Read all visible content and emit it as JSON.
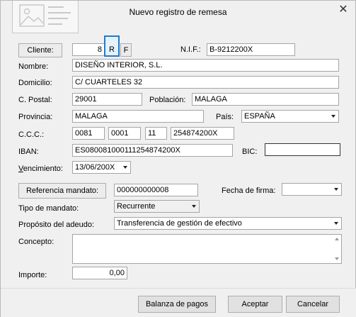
{
  "window": {
    "title": "Nuevo registro de remesa",
    "close_glyph": "✕"
  },
  "cliente": {
    "button_label": "Cliente:",
    "code": "8",
    "btn_r": "R",
    "btn_f": "F"
  },
  "nif": {
    "label": "N.I.F.:",
    "value": "B-9212200X"
  },
  "nombre": {
    "label": "Nombre:",
    "value": "DISEÑO INTERIOR, S.L."
  },
  "domicilio": {
    "label": "Domicilio:",
    "value": "C/ CUARTELES 32"
  },
  "cpostal": {
    "label": "C. Postal:",
    "value": "29001"
  },
  "poblacion": {
    "label": "Población:",
    "value": "MALAGA"
  },
  "provincia": {
    "label": "Provincia:",
    "value": "MALAGA"
  },
  "pais": {
    "label": "País:",
    "value": "ESPAÑA"
  },
  "ccc": {
    "label": "C.C.C.:",
    "entidad": "0081",
    "oficina": "0001",
    "dc": "11",
    "cuenta": "254874200X"
  },
  "iban": {
    "label": "IBAN:",
    "value": "ES0800810001112548742​00X"
  },
  "bic": {
    "label": "BIC:",
    "value": ""
  },
  "vencimiento": {
    "label": "Vencimiento:",
    "value": "13/06/200X"
  },
  "mandato": {
    "button_label": "Referencia mandato:",
    "value": "000000000008"
  },
  "fecha_firma": {
    "label": "Fecha de firma:",
    "value": ""
  },
  "tipo_mandato": {
    "label": "Tipo de mandato:",
    "value": "Recurrente"
  },
  "proposito": {
    "label": "Propósito del adeudo:",
    "value": "Transferencia de gestión de efectivo"
  },
  "concepto": {
    "label": "Concepto:",
    "value": ""
  },
  "importe": {
    "label": "Importe:",
    "value": "0,00"
  },
  "footer": {
    "balanza": "Balanza de pagos",
    "aceptar": "Aceptar",
    "cancelar": "Cancelar"
  },
  "colors": {
    "focus_border": "#1e7ad2",
    "field_border": "#a5a5a5",
    "background": "#f0f0f0"
  },
  "icons": {
    "logo": "image-placeholder-icon",
    "dropdown": "chevron-down-icon"
  }
}
